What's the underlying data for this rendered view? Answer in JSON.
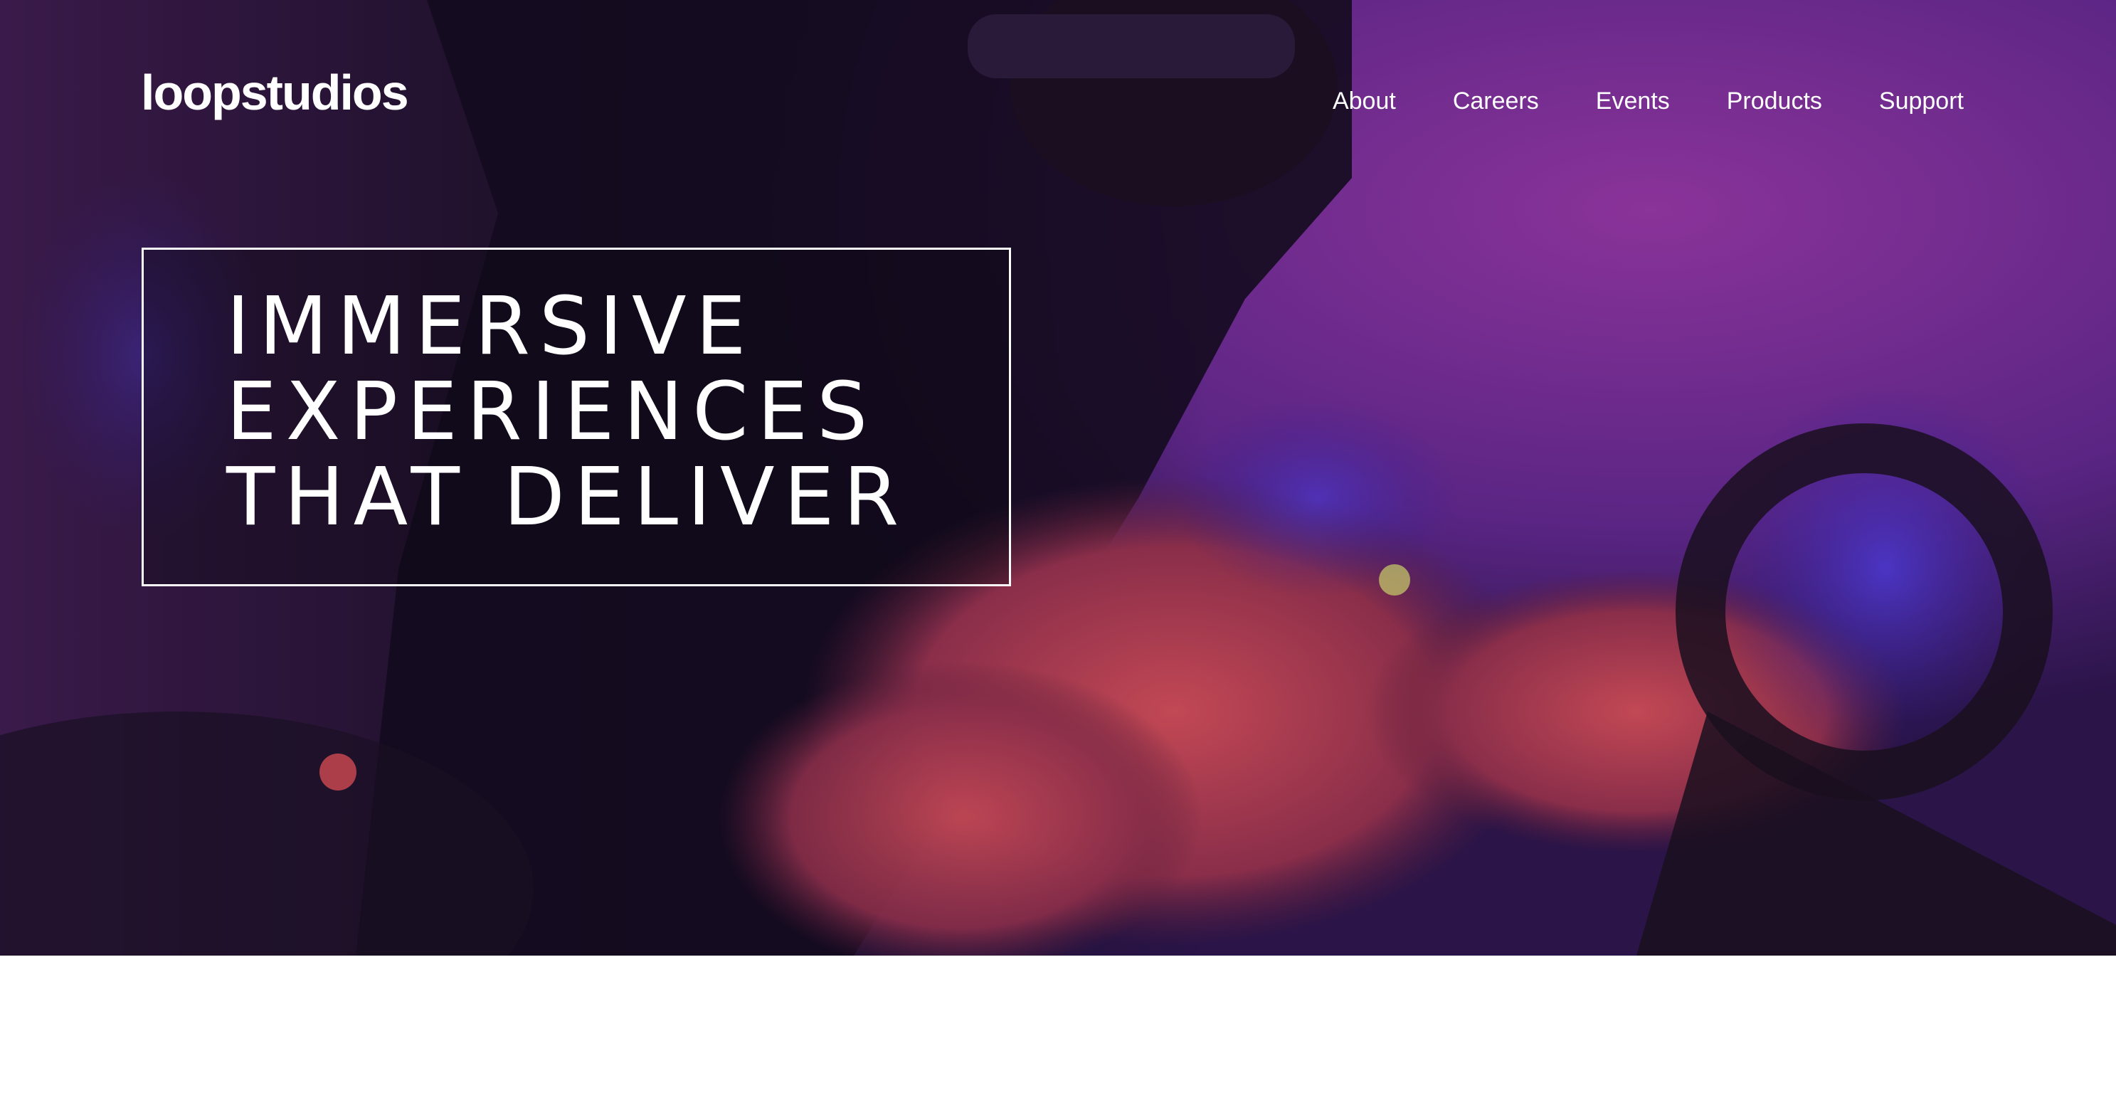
{
  "brand": {
    "logo_text": "loopstudios"
  },
  "nav": {
    "items": [
      {
        "label": "About"
      },
      {
        "label": "Careers"
      },
      {
        "label": "Events"
      },
      {
        "label": "Products"
      },
      {
        "label": "Support"
      }
    ]
  },
  "hero": {
    "headline_lines": [
      "IMMERSIVE",
      "EXPERIENCES",
      "THAT DELIVER"
    ],
    "image": "person-vr-headset-steering-wheel"
  },
  "colors": {
    "hero_overlay_dark": "#140c24",
    "hero_purple": "#6a2a8c",
    "hero_red": "#a83a4a",
    "text": "#ffffff",
    "page_bg": "#ffffff"
  }
}
